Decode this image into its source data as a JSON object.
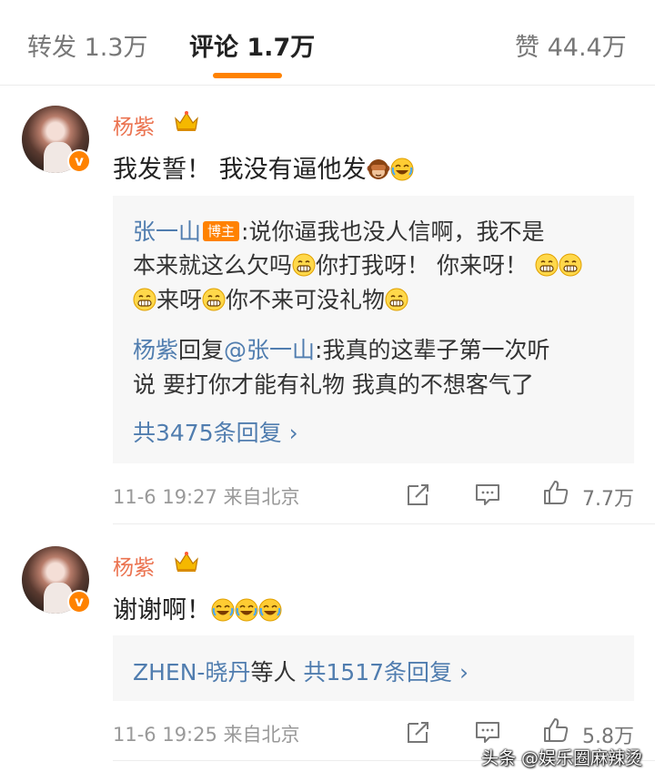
{
  "tabs": {
    "repost": "转发 1.3万",
    "comment": "评论 1.7万",
    "like": "赞 44.4万"
  },
  "colors": {
    "accent": "#ff8200",
    "link": "#507daf",
    "username": "#eb7350"
  },
  "comments": [
    {
      "username": "杨紫",
      "verified_mark": "v",
      "text": "我发誓！ 我没有逼他发",
      "emoji_after_text": [
        "see-no-evil-monkey-icon",
        "laugh-cry-icon"
      ],
      "reply_box": {
        "reply1_author": "张一山",
        "reply1_tag": "博主",
        "reply1_line1": ":说你逼我也没人信啊，我不是",
        "reply1_line2a": "本来就这么欠吗",
        "reply1_line2b": "你打我呀！ 你来呀！",
        "reply1_line3a": "来呀",
        "reply1_line3b": "你不来可没礼物",
        "reply2_author": "杨紫",
        "reply2_mid": "回复",
        "reply2_mention": "@张一山",
        "reply2_line1_rest": ":我真的这辈子第一次听",
        "reply2_line2": "说 要打你才能有礼物 我真的不想客气了",
        "more": "共3475条回复 ›"
      },
      "meta": "11-6 19:27  来自北京",
      "likes": "7.7万"
    },
    {
      "username": "杨紫",
      "verified_mark": "v",
      "text": "谢谢啊！",
      "emoji_after_text": [
        "laugh-cry-icon",
        "laugh-cry-icon",
        "laugh-cry-icon"
      ],
      "reply_box": {
        "names": "ZHEN-晓丹",
        "names_suffix": "等人 ",
        "more": "共1517条回复 ›"
      },
      "meta": "11-6 19:25  来自北京",
      "likes": "5.8万"
    }
  ],
  "watermark": "头条 @娱乐圈麻辣烫"
}
